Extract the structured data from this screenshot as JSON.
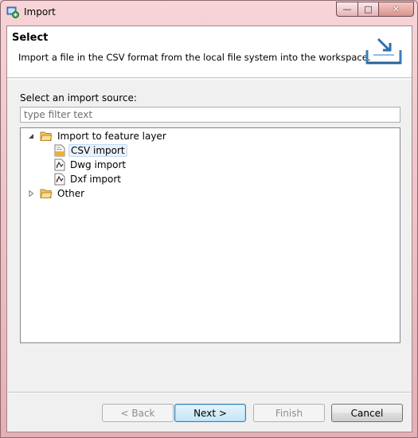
{
  "window": {
    "title": "Import",
    "minimize_glyph": "—",
    "maximize_glyph": "□",
    "close_glyph": "✕"
  },
  "header": {
    "title": "Select",
    "description": "Import a file in the CSV format from the local file system into the workspace."
  },
  "filter": {
    "label": "Select an import source:",
    "placeholder": "type filter text"
  },
  "tree": {
    "items": [
      {
        "label": "Import to feature layer",
        "expanded": true,
        "icon": "folder-open-icon"
      },
      {
        "label": "CSV import",
        "selected": true,
        "icon": "csv-file-icon"
      },
      {
        "label": "Dwg import",
        "icon": "dwg-file-icon"
      },
      {
        "label": "Dxf import",
        "icon": "dxf-file-icon"
      },
      {
        "label": "Other",
        "expanded": false,
        "icon": "folder-icon"
      }
    ]
  },
  "buttons": {
    "back": "< Back",
    "next": "Next >",
    "finish": "Finish",
    "cancel": "Cancel"
  }
}
